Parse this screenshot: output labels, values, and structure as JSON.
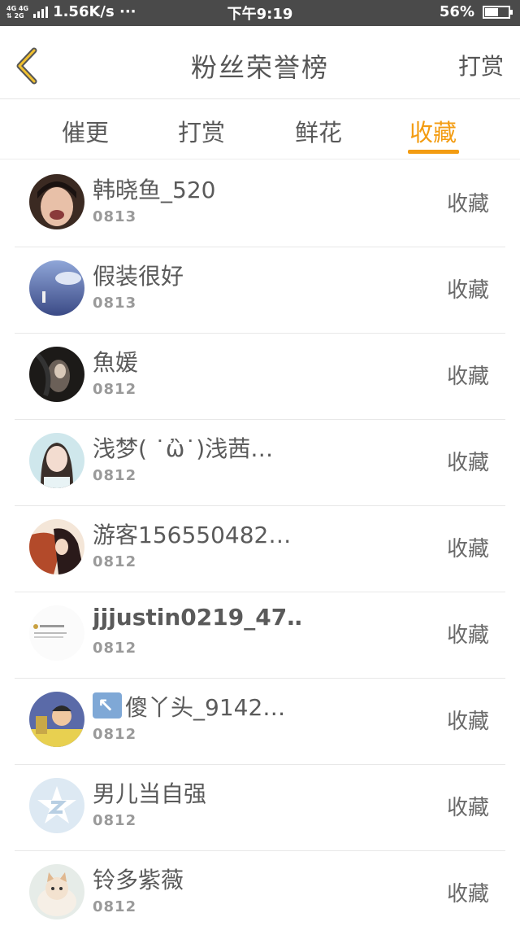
{
  "status_bar": {
    "network": "1.56K/s ···",
    "time": "下午9:19",
    "battery": "56%",
    "battery_level": 0.56
  },
  "header": {
    "title": "粉丝荣誉榜",
    "right_action": "打赏"
  },
  "tabs": [
    {
      "label": "催更",
      "active": false
    },
    {
      "label": "打赏",
      "active": false
    },
    {
      "label": "鲜花",
      "active": false
    },
    {
      "label": "收藏",
      "active": true
    }
  ],
  "accent_color": "#f39c12",
  "fans": [
    {
      "name": "韩晓鱼_520",
      "date": "0813",
      "action": "收藏",
      "avatar": "avatar-photo-boy"
    },
    {
      "name": "假装很好",
      "date": "0813",
      "action": "收藏",
      "avatar": "avatar-photo-sky"
    },
    {
      "name": "魚媛",
      "date": "0812",
      "action": "收藏",
      "avatar": "avatar-photo-dark"
    },
    {
      "name": "浅梦( ˙ὢ˙)浅茜…",
      "date": "0812",
      "action": "收藏",
      "avatar": "avatar-photo-girl"
    },
    {
      "name": "游客156550482…",
      "date": "0812",
      "action": "收藏",
      "avatar": "avatar-anime"
    },
    {
      "name": "jjjustin0219_47…",
      "date": "0812",
      "action": "收藏",
      "avatar": "avatar-document"
    },
    {
      "name": "傻丫头_9142…",
      "date": "0812",
      "action": "收藏",
      "avatar": "avatar-cartoon",
      "prefix_icon": "arrow-up-left-emoji"
    },
    {
      "name": "男儿当自强",
      "date": "0812",
      "action": "收藏",
      "avatar": "avatar-default-star"
    },
    {
      "name": "铃多紫薇",
      "date": "0812",
      "action": "收藏",
      "avatar": "avatar-cat"
    }
  ]
}
